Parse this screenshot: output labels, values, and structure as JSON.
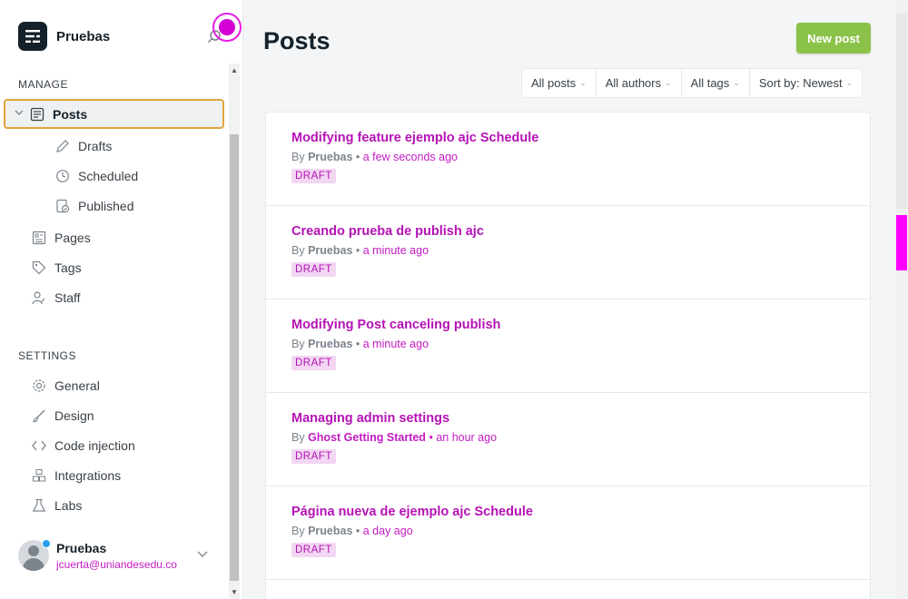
{
  "app": {
    "site_name": "Pruebas"
  },
  "sidebar": {
    "manage_label": "MANAGE",
    "settings_label": "SETTINGS",
    "posts_label": "Posts",
    "drafts_label": "Drafts",
    "scheduled_label": "Scheduled",
    "published_label": "Published",
    "pages_label": "Pages",
    "tags_label": "Tags",
    "staff_label": "Staff",
    "general_label": "General",
    "design_label": "Design",
    "code_injection_label": "Code injection",
    "integrations_label": "Integrations",
    "labs_label": "Labs"
  },
  "user": {
    "name": "Pruebas",
    "email": "jcuerta@uniandesedu.co"
  },
  "header": {
    "title": "Posts",
    "new_post_label": "New post"
  },
  "filters": {
    "type": "All posts",
    "authors": "All authors",
    "tags": "All tags",
    "sort": "Sort by: Newest"
  },
  "posts": [
    {
      "title": "Modifying feature ejemplo ajc Schedule",
      "by": "By",
      "author": "Pruebas",
      "when": "a few seconds ago",
      "status": "DRAFT"
    },
    {
      "title": "Creando prueba de publish ajc",
      "by": "By",
      "author": "Pruebas",
      "when": "a minute ago",
      "status": "DRAFT"
    },
    {
      "title": "Modifying Post canceling publish",
      "by": "By",
      "author": "Pruebas",
      "when": "a minute ago",
      "status": "DRAFT"
    },
    {
      "title": "Managing admin settings",
      "by": "By",
      "author": "Ghost Getting Started",
      "when": "an hour ago",
      "status": "DRAFT"
    },
    {
      "title": "Página nueva de ejemplo ajc Schedule",
      "by": "By",
      "author": "Pruebas",
      "when": "a day ago",
      "status": "DRAFT"
    }
  ],
  "colors": {
    "accent": "#8bc34a",
    "draft": "#b512b5",
    "focus": "#e0a53a"
  }
}
